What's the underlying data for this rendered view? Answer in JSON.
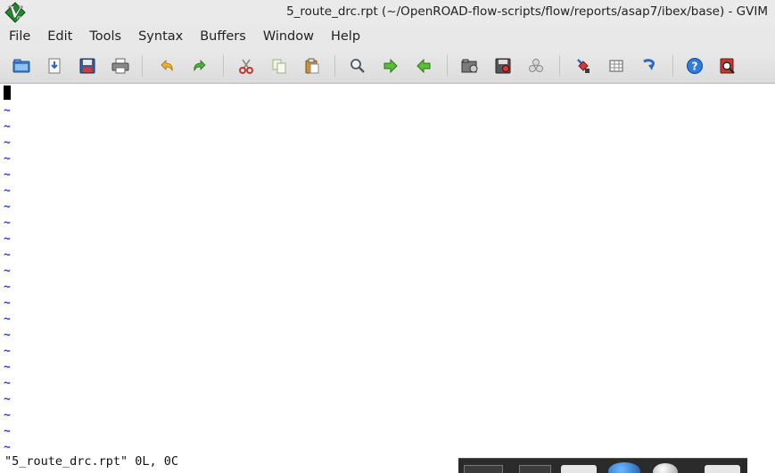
{
  "window": {
    "title": "5_route_drc.rpt (~/OpenROAD-flow-scripts/flow/reports/asap7/ibex/base) - GVIM"
  },
  "menu": {
    "items": [
      "File",
      "Edit",
      "Tools",
      "Syntax",
      "Buffers",
      "Window",
      "Help"
    ]
  },
  "toolbar": {
    "buttons": [
      {
        "icon": "open-folder-icon"
      },
      {
        "icon": "save-download-icon"
      },
      {
        "icon": "save-floppy-icon"
      },
      {
        "icon": "print-icon"
      },
      {
        "icon": "undo-icon"
      },
      {
        "icon": "redo-icon"
      },
      {
        "icon": "cut-scissors-icon"
      },
      {
        "icon": "copy-icon"
      },
      {
        "icon": "paste-icon"
      },
      {
        "icon": "find-magnifier-icon"
      },
      {
        "icon": "find-next-arrow-icon"
      },
      {
        "icon": "find-previous-arrow-icon"
      },
      {
        "icon": "load-session-icon"
      },
      {
        "icon": "save-session-icon"
      },
      {
        "icon": "run-script-icon"
      },
      {
        "icon": "make-icon"
      },
      {
        "icon": "shell-table-icon"
      },
      {
        "icon": "tags-jump-icon"
      },
      {
        "icon": "help-icon"
      },
      {
        "icon": "find-help-icon"
      }
    ]
  },
  "editor": {
    "empty_line_marker": "~",
    "colors": {
      "tilde": "#2a3bff",
      "cursor": "#000000",
      "background": "#ffffff"
    }
  },
  "statusline": {
    "message": "\"5_route_drc.rpt\" 0L, 0C"
  }
}
